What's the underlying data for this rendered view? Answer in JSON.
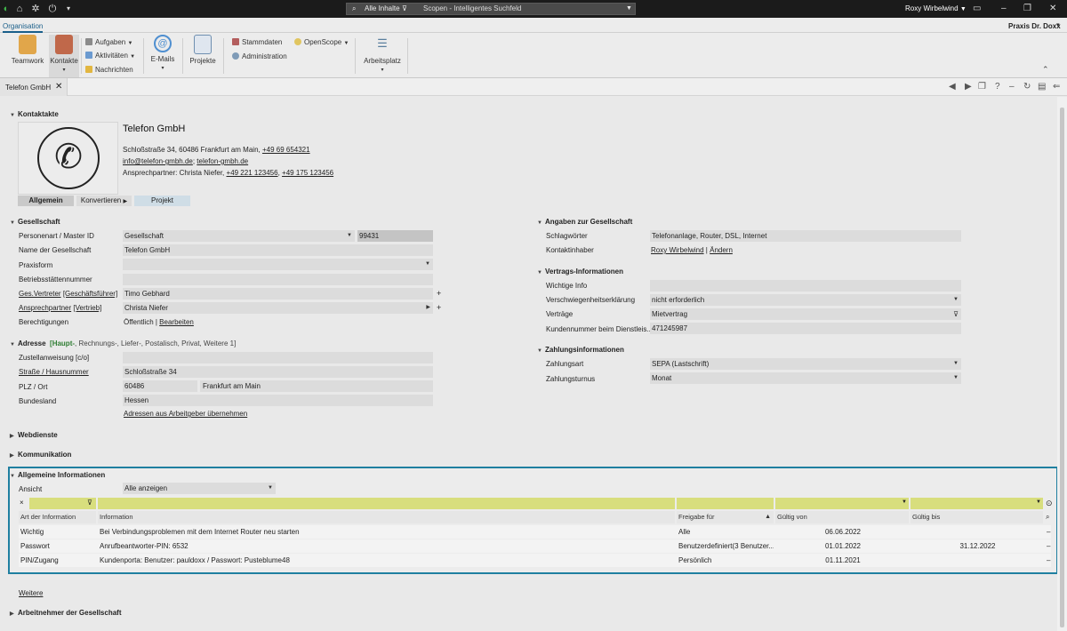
{
  "titlebar": {
    "search_scope": "Alle Inhalte",
    "search_placeholder": "Scopen - Intelligentes Suchfeld",
    "user_name": "Roxy Wirbelwind"
  },
  "ribbon": {
    "active_tab": "Organisation",
    "practice_name": "Praxis Dr. Doxx",
    "buttons": {
      "teamwork": "Teamwork",
      "kontakte": "Kontakte",
      "aufgaben": "Aufgaben",
      "aktivitaeten": "Aktivitäten",
      "nachrichten": "Nachrichten",
      "emails": "E-Mails",
      "projekte": "Projekte",
      "stammdaten": "Stammdaten",
      "openscope": "OpenScope",
      "administration": "Administration",
      "arbeitsplatz": "Arbeitsplatz"
    }
  },
  "doc_tab": {
    "title": "Telefon GmbH"
  },
  "contact": {
    "section": "Kontaktakte",
    "name": "Telefon GmbH",
    "address_line": "Schloßstraße 34, 60486 Frankfurt am Main,",
    "phone": "+49 69 654321",
    "email": "info@telefon-gmbh.de",
    "website": "telefon-gmbh.de",
    "contact_prefix": "Ansprechpartner: Christa Niefer,",
    "contact_phone1": "+49 221 123456",
    "contact_phone2": "+49 175 123456",
    "tabs": {
      "allgemein": "Allgemein",
      "konvertieren": "Konvertieren",
      "projekt": "Projekt"
    }
  },
  "gesellschaft": {
    "section": "Gesellschaft",
    "labels": {
      "personenart": "Personenart / Master ID",
      "name": "Name der Gesellschaft",
      "praxisform": "Praxisform",
      "betrieb": "Betriebsstättennummer",
      "ges_vertreter": "Ges.Vertreter",
      "ges_vertreter_role": "[Geschäftsführer]",
      "ansprechpartner": "Ansprechpartner",
      "ansprechpartner_role": "[Vertrieb]",
      "berechtigungen": "Berechtigungen"
    },
    "values": {
      "personenart": "Gesellschaft",
      "master_id": "99431",
      "name": "Telefon GmbH",
      "praxisform": "",
      "betrieb": "",
      "ges_vertreter": "Timo Gebhard",
      "ansprechpartner": "Christa Niefer",
      "berechtigungen_prefix": "Öffentlich | ",
      "berechtigungen_link": "Bearbeiten"
    }
  },
  "adresse": {
    "section": "Adresse",
    "types_active": "[Haupt-",
    "types_rest": ", Rechnungs-, Liefer-, Postalisch, Privat, Weitere 1]",
    "labels": {
      "zustell": "Zustellanweisung [c/o]",
      "strasse": "Straße / Hausnummer",
      "plz": "PLZ / Ort",
      "bundesland": "Bundesland"
    },
    "values": {
      "zustell": "",
      "strasse": "Schloßstraße 34",
      "plz": "60486",
      "ort": "Frankfurt am Main",
      "bundesland": "Hessen"
    },
    "link": "Adressen aus Arbeitgeber übernehmen"
  },
  "collapsed_sections": {
    "webdienste": "Webdienste",
    "kommunikation": "Kommunikation"
  },
  "angaben": {
    "section": "Angaben zur Gesellschaft",
    "schlagwoerter_label": "Schlagwörter",
    "schlagwoerter": "Telefonanlage, Router, DSL, Internet",
    "kontaktinhaber_label": "Kontaktinhaber",
    "kontaktinhaber": "Roxy Wirbelwind",
    "aendern": "Ändern"
  },
  "vertrag": {
    "section": "Vertrags-Informationen",
    "labels": {
      "wichtige": "Wichtige Info",
      "verschw": "Verschwiegenheitserklärung",
      "vertraege": "Verträge",
      "kundennr": "Kundennummer beim Dienstleis..."
    },
    "values": {
      "wichtige": "",
      "verschw": "nicht erforderlich",
      "vertraege": "Mietvertrag",
      "kundennr": "471245987"
    }
  },
  "zahlung": {
    "section": "Zahlungsinformationen",
    "labels": {
      "zahlungsart": "Zahlungsart",
      "turnus": "Zahlungsturnus"
    },
    "values": {
      "zahlungsart": "SEPA (Lastschrift)",
      "turnus": "Monat"
    }
  },
  "allgemeine_info": {
    "section": "Allgemeine Informationen",
    "ansicht_label": "Ansicht",
    "ansicht_value": "Alle anzeigen",
    "columns": [
      "Art der Information",
      "Information",
      "Freigabe für",
      "Gültig von",
      "Gültig bis"
    ],
    "rows": [
      [
        "Wichtig",
        "Bei Verbindungsproblemen mit dem Internet Router neu starten",
        "Alle",
        "06.06.2022",
        ""
      ],
      [
        "Passwort",
        "Anrufbeantworter-PIN: 6532",
        "Benutzerdefiniert(3 Benutzer...",
        "01.01.2022",
        "31.12.2022"
      ],
      [
        "PIN/Zugang",
        "Kundenporta: Benutzer: pauldoxx / Passwort: Pusteblume48",
        "Persönlich",
        "01.11.2021",
        ""
      ]
    ]
  },
  "footer": {
    "weitere": "Weitere",
    "arbeitnehmer": "Arbeitnehmer der Gesellschaft"
  },
  "colors": {
    "accent_border": "#1f7fa0",
    "filter_row": "#d8de7d",
    "titlebar": "#1b1b1b"
  }
}
